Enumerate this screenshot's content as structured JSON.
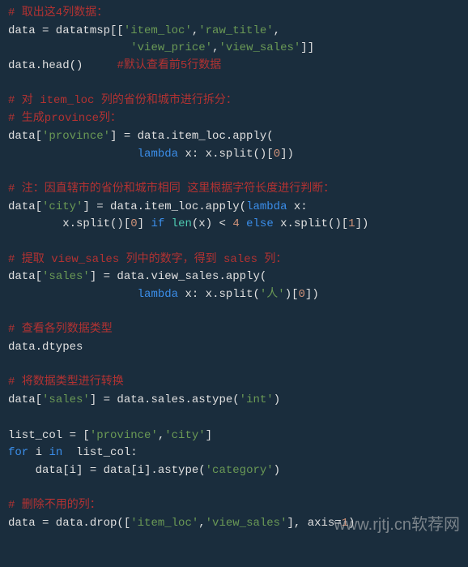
{
  "code": {
    "c1": "# 取出这4列数据：",
    "l1a": "data = datatmsp[[",
    "s1": "'item_loc'",
    "s2": "'raw_title'",
    "l2pad": "                  ",
    "s3": "'view_price'",
    "s4": "'view_sales'",
    "l2end": "]]",
    "l3a": "data.head()",
    "l3pad": "     ",
    "c3": "#默认查看前5行数据",
    "c4": "# 对 item_loc 列的省份和城市进行拆分：",
    "c5": "# 生成province列：",
    "l6a": "data[",
    "s5": "'province'",
    "l6b": "] = data.item_loc.apply(",
    "l7pad": "                   ",
    "kw_lambda": "lambda",
    "l7b": " x: x.split()[",
    "n0": "0",
    "l7c": "])",
    "c6": "# 注：因直辖市的省份和城市相同 这里根据字符长度进行判断：",
    "l8a": "data[",
    "s6": "'city'",
    "l8b": "] = data.item_loc.apply(",
    "l8c": " x:",
    "l9pad": "        ",
    "l9a": "x.split()[",
    "l9b": "] ",
    "kw_if": "if",
    "fn_len": "len",
    "l9c": "(x) < ",
    "n4": "4",
    "kw_else": "else",
    "l9d": " x.split()[",
    "n1": "1",
    "l9e": "])",
    "c7": "# 提取 view_sales 列中的数字，得到 sales 列：",
    "l10a": "data[",
    "s7": "'sales'",
    "l10b": "] = data.view_sales.apply(",
    "l11pad": "                   ",
    "l11a": " x: x.split(",
    "s8": "'人'",
    "l11b": ")[",
    "l11c": "])",
    "c8": "# 查看各列数据类型",
    "l12": "data.dtypes",
    "c9": "# 将数据类型进行转换",
    "l13a": "data[",
    "l13b": "] = data.sales.astype(",
    "s9": "'int'",
    "l13c": ")",
    "l14a": "list_col = [",
    "s10": "'province'",
    "s11": "'city'",
    "l14b": "]",
    "kw_for": "for",
    "l15a": " i ",
    "kw_in": "in",
    "l15b": "  list_col:",
    "l16pad": "    ",
    "l16a": "data[i] = data[i].astype(",
    "s12": "'category'",
    "l16b": ")",
    "c10": "# 删除不用的列：",
    "l17a": "data = data.drop([",
    "s13": "'item_loc'",
    "s14": "'view_sales'",
    "l17b": "], axis=",
    "l17c": ")"
  },
  "watermark": "www.rjtj.cn软荐网"
}
